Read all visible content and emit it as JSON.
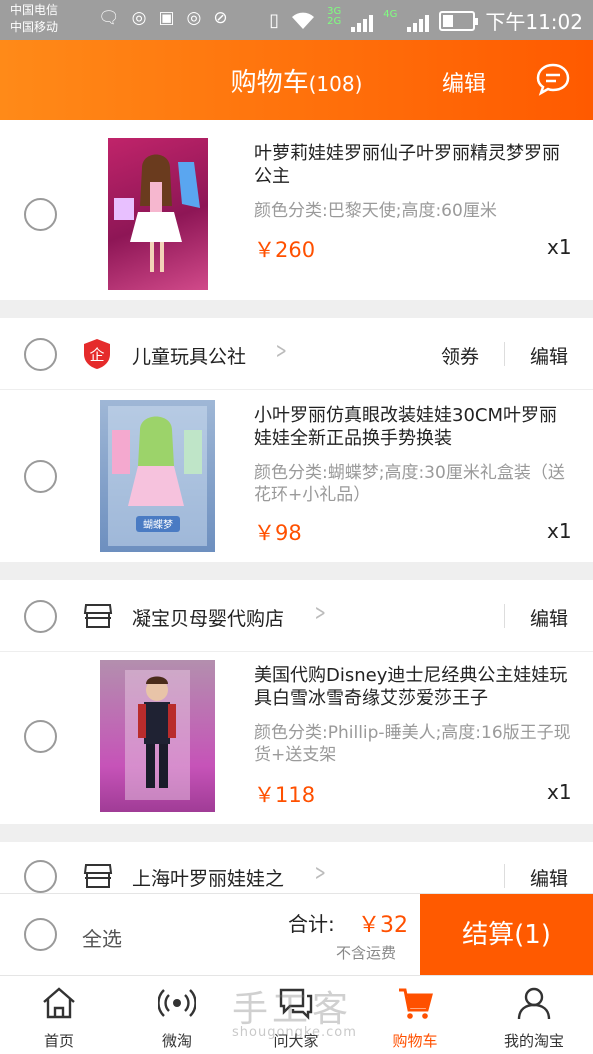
{
  "status_bar": {
    "carrier1": "中国电信",
    "carrier2": "中国移动",
    "net1": "3G",
    "net2": "2G",
    "net3": "4G",
    "time": "下午11:02"
  },
  "header": {
    "title": "购物车",
    "count": "(108)",
    "edit_label": "编辑"
  },
  "items": [
    {
      "title": "叶萝莉娃娃罗丽仙子叶罗丽精灵梦罗丽公主",
      "spec": "颜色分类:巴黎天使;高度:60厘米",
      "price": "￥260",
      "qty": "x1"
    },
    {
      "title": "小叶罗丽仿真眼改装娃娃30CM叶罗丽娃娃全新正品换手势换装",
      "spec": "颜色分类:蝴蝶梦;高度:30厘米礼盒装（送花环+小礼品）",
      "price": "￥98",
      "qty": "x1",
      "box_text": "蝴蝶梦"
    },
    {
      "title": "美国代购Disney迪士尼经典公主娃娃玩具白雪冰雪奇缘艾莎爱莎王子",
      "spec": "颜色分类:Phillip-睡美人;高度:16版王子现货+送支架",
      "price": "￥118",
      "qty": "x1"
    }
  ],
  "shops": [
    {
      "name": "儿童玩具公社",
      "coupon": "领券",
      "edit": "编辑",
      "logo_glyph": "企"
    },
    {
      "name": "凝宝贝母婴代购店",
      "edit": "编辑"
    },
    {
      "name": "上海叶罗丽娃娃之",
      "edit": "编辑"
    }
  ],
  "footer": {
    "select_all": "全选",
    "total_label": "合计:",
    "total_value": "￥32",
    "shipping_note": "不含运费",
    "checkout_label": "结算(1)"
  },
  "tabs": [
    {
      "label": "首页",
      "icon": "home-icon"
    },
    {
      "label": "微淘",
      "icon": "weitao-icon"
    },
    {
      "label": "问大家",
      "icon": "chat-icon"
    },
    {
      "label": "购物车",
      "icon": "cart-icon",
      "active": true
    },
    {
      "label": "我的淘宝",
      "icon": "user-icon"
    }
  ],
  "watermark": {
    "text": "手工客",
    "url": "shougongke.com"
  },
  "colors": {
    "accent": "#ff5000",
    "header_start": "#ff8a18",
    "header_end": "#ff5a00"
  }
}
